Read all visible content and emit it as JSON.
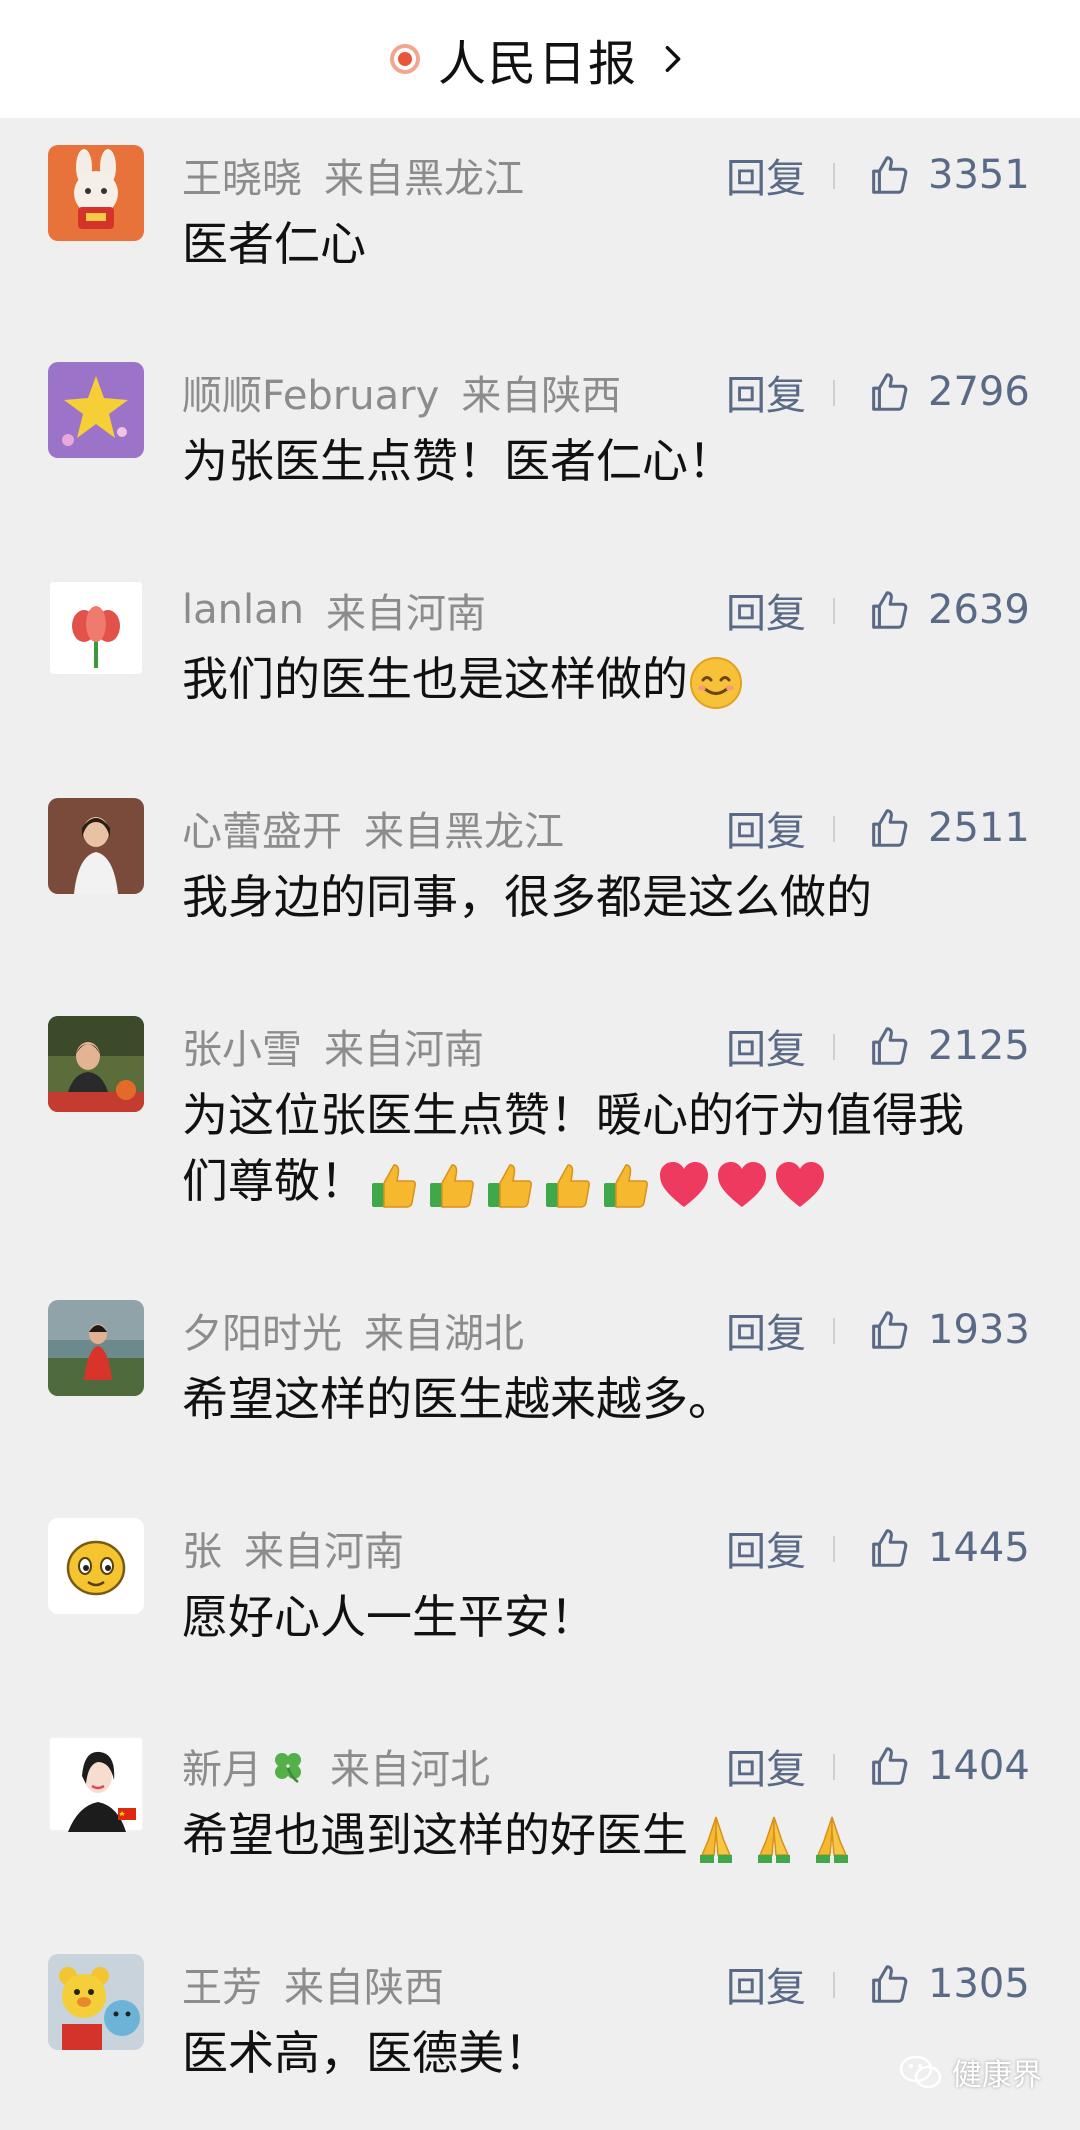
{
  "header": {
    "title": "人民日报"
  },
  "comments": [
    {
      "name": "王晓晓",
      "location": "来自黑龙江",
      "reply": "回复",
      "likes": "3351",
      "text": "医者仁心"
    },
    {
      "name": "顺顺February",
      "location": "来自陕西",
      "reply": "回复",
      "likes": "2796",
      "text": "为张医生点赞！医者仁心！"
    },
    {
      "name": "lanlan",
      "location": "来自河南",
      "reply": "回复",
      "likes": "2639",
      "text": "我们的医生也是这样做的"
    },
    {
      "name": "心蕾盛开",
      "location": "来自黑龙江",
      "reply": "回复",
      "likes": "2511",
      "text": "我身边的同事，很多都是这么做的"
    },
    {
      "name": "张小雪",
      "location": "来自河南",
      "reply": "回复",
      "likes": "2125",
      "text_line1": "为这位张医生点赞！暖心的行为值得我",
      "text_line2": "们尊敬！"
    },
    {
      "name": "夕阳时光",
      "location": "来自湖北",
      "reply": "回复",
      "likes": "1933",
      "text": "希望这样的医生越来越多。"
    },
    {
      "name": "张",
      "location": "来自河南",
      "reply": "回复",
      "likes": "1445",
      "text": "愿好心人一生平安！"
    },
    {
      "name": "新月",
      "location": "来自河北",
      "reply": "回复",
      "likes": "1404",
      "text": "希望也遇到这样的好医生"
    },
    {
      "name": "王芳",
      "location": "来自陕西",
      "reply": "回复",
      "likes": "1305",
      "text": "医术高，医德美！"
    }
  ],
  "avatars": [
    "rabbit-avatar",
    "star-avatar",
    "tulip-avatar",
    "woman-portrait-avatar",
    "woman-office-avatar",
    "woman-outdoor-avatar",
    "emoji-face-avatar",
    "woman-drawing-avatar",
    "teddy-bears-avatar"
  ],
  "watermark": {
    "text": "健康界"
  },
  "colors": {
    "meta": "#8c8c8c",
    "action": "#5a6a86",
    "text": "#111111",
    "background": "#efefef"
  }
}
